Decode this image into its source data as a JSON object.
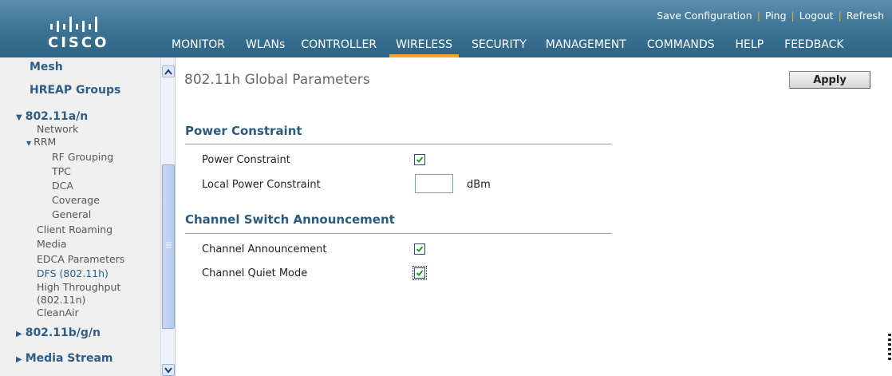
{
  "header": {
    "brand": "CISCO",
    "util_links": [
      {
        "label": "Save Configuration"
      },
      {
        "label": "Ping"
      },
      {
        "label": "Logout"
      },
      {
        "label": "Refresh"
      }
    ],
    "nav": [
      {
        "label": "MONITOR"
      },
      {
        "label": "WLANs"
      },
      {
        "label": "CONTROLLER"
      },
      {
        "label": "WIRELESS",
        "active": true
      },
      {
        "label": "SECURITY"
      },
      {
        "label": "MANAGEMENT"
      },
      {
        "label": "COMMANDS"
      },
      {
        "label": "HELP"
      },
      {
        "label": "FEEDBACK"
      }
    ],
    "accent_color": "#f5a623",
    "bar_color": "#3f7596"
  },
  "sidebar": {
    "items": [
      {
        "label": "Mesh",
        "level": 0
      },
      {
        "label": "HREAP Groups",
        "level": 0
      },
      {
        "label": "802.11a/n",
        "level": 0,
        "expanded": true
      },
      {
        "label": "Network",
        "level": 1
      },
      {
        "label": "RRM",
        "level": 1,
        "expanded": true
      },
      {
        "label": "RF Grouping",
        "level": 2
      },
      {
        "label": "TPC",
        "level": 2
      },
      {
        "label": "DCA",
        "level": 2
      },
      {
        "label": "Coverage",
        "level": 2
      },
      {
        "label": "General",
        "level": 2
      },
      {
        "label": "Client Roaming",
        "level": 1
      },
      {
        "label": "Media",
        "level": 1
      },
      {
        "label": "EDCA Parameters",
        "level": 1
      },
      {
        "label": "DFS (802.11h)",
        "level": 1,
        "selected": true
      },
      {
        "label": "High Throughput",
        "level": 1
      },
      {
        "label": "(802.11n)",
        "level": 1
      },
      {
        "label": "CleanAir",
        "level": 1
      },
      {
        "label": "802.11b/g/n",
        "level": 0,
        "expanded": false
      },
      {
        "label": "Media Stream",
        "level": 0,
        "expanded": false
      }
    ]
  },
  "main": {
    "title": "802.11h Global Parameters",
    "apply_label": "Apply",
    "sections": [
      {
        "title": "Power Constraint",
        "fields": [
          {
            "label": "Power Constraint",
            "type": "checkbox",
            "checked": true
          },
          {
            "label": "Local Power Constraint",
            "type": "text",
            "value": "",
            "unit": "dBm"
          }
        ]
      },
      {
        "title": "Channel Switch Announcement",
        "fields": [
          {
            "label": "Channel Announcement",
            "type": "checkbox",
            "checked": true
          },
          {
            "label": "Channel Quiet Mode",
            "type": "checkbox",
            "checked": true
          }
        ]
      }
    ]
  }
}
